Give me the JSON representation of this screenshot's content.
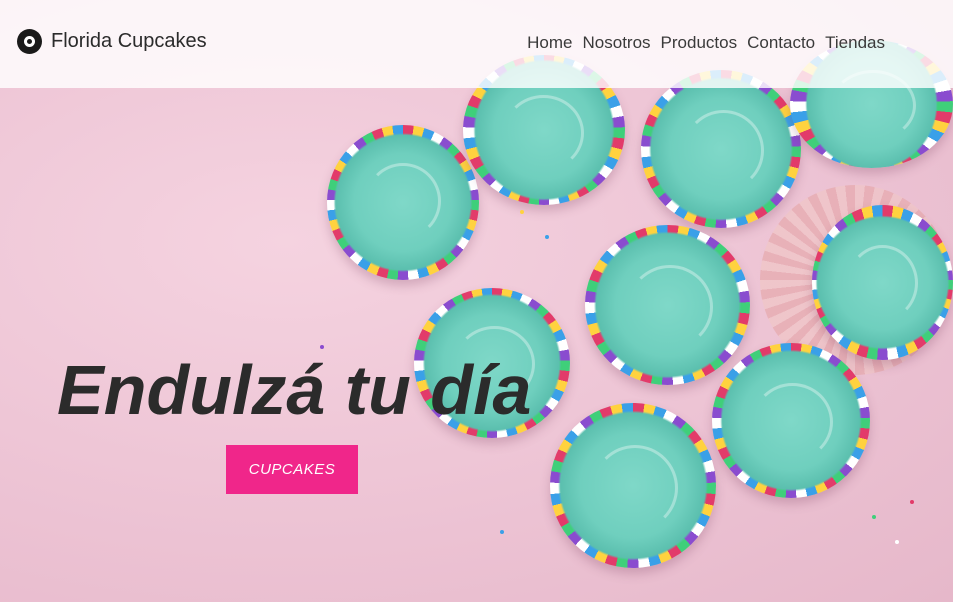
{
  "brand": {
    "name": "Florida Cupcakes",
    "logo_icon": "ring-logo-icon"
  },
  "nav": {
    "items": [
      {
        "label": "Home"
      },
      {
        "label": "Nosotros"
      },
      {
        "label": "Productos"
      },
      {
        "label": "Contacto"
      },
      {
        "label": "Tiendas"
      }
    ]
  },
  "hero": {
    "headline": "Endulzá tu día",
    "cta_label": "CUPCAKES",
    "background_image": "cupcakes-with-mint-frosting-and-sprinkles-photo"
  },
  "colors": {
    "accent": "#f0268a",
    "background_pink": "#efc9d8",
    "frosting_mint": "#6fcfbe",
    "text_dark": "#2b2b2b"
  }
}
